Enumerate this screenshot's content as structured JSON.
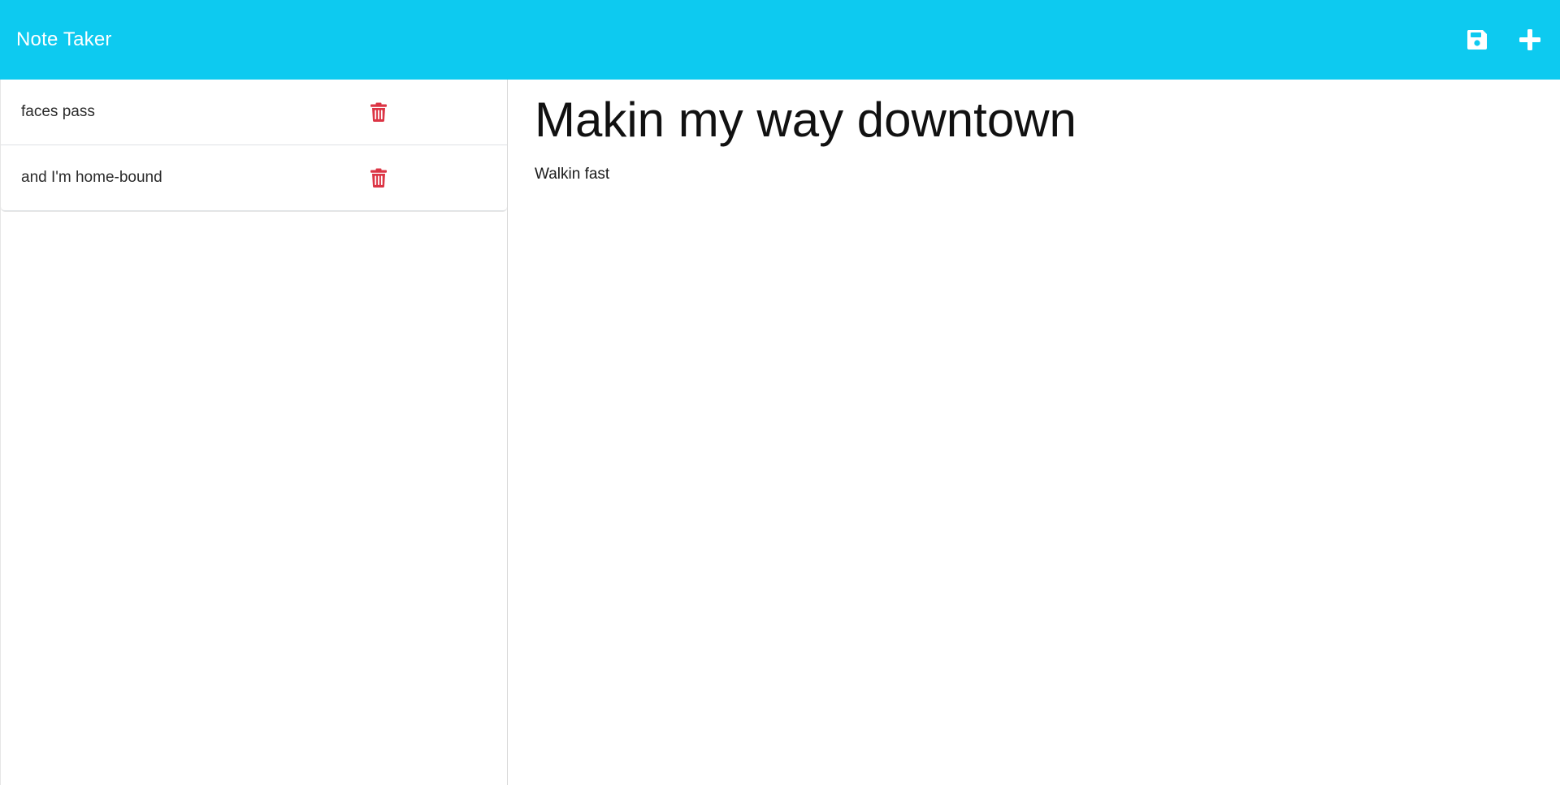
{
  "app": {
    "title": "Note Taker"
  },
  "toolbar": {
    "save_icon": "floppy-disk-icon",
    "new_icon": "plus-icon",
    "icon_color": "#ffffff",
    "background_color": "#0dcaf0"
  },
  "sidebar": {
    "notes": [
      {
        "title": "faces pass",
        "delete_icon": "trash-icon"
      },
      {
        "title": "and I'm home-bound",
        "delete_icon": "trash-icon"
      }
    ],
    "delete_color": "#dc3545"
  },
  "editor": {
    "title": "Makin my way downtown",
    "text": "Walkin fast"
  }
}
